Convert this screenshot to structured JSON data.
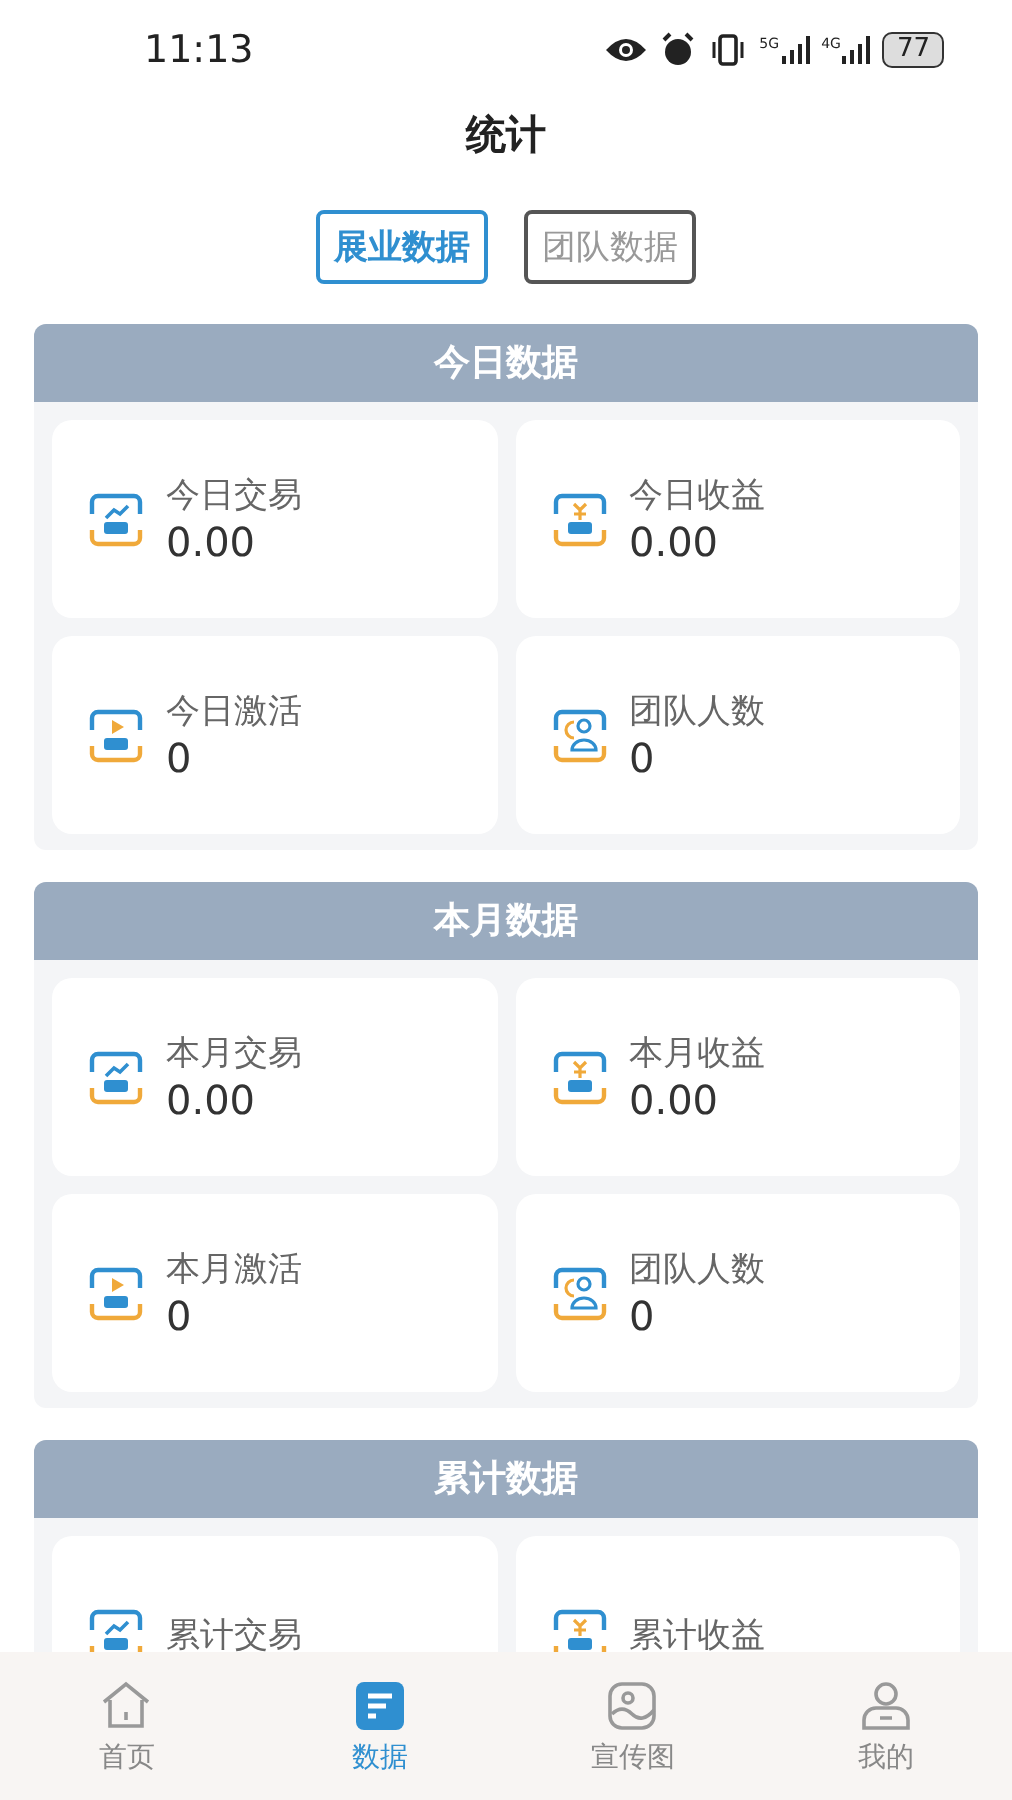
{
  "status_bar": {
    "time": "11:13",
    "signals": [
      "5G",
      "4G"
    ],
    "battery": "77"
  },
  "title": "统计",
  "tabs": [
    {
      "label": "展业数据",
      "selected": true
    },
    {
      "label": "团队数据",
      "selected": false
    }
  ],
  "sections": [
    {
      "title": "今日数据",
      "items": [
        {
          "kind": "trade",
          "label": "今日交易",
          "value": "0.00"
        },
        {
          "kind": "income",
          "label": "今日收益",
          "value": "0.00"
        },
        {
          "kind": "activate",
          "label": "今日激活",
          "value": "0"
        },
        {
          "kind": "team",
          "label": "团队人数",
          "value": "0"
        }
      ]
    },
    {
      "title": "本月数据",
      "items": [
        {
          "kind": "trade",
          "label": "本月交易",
          "value": "0.00"
        },
        {
          "kind": "income",
          "label": "本月收益",
          "value": "0.00"
        },
        {
          "kind": "activate",
          "label": "本月激活",
          "value": "0"
        },
        {
          "kind": "team",
          "label": "团队人数",
          "value": "0"
        }
      ]
    },
    {
      "title": "累计数据",
      "items": [
        {
          "kind": "trade",
          "label": "累计交易"
        },
        {
          "kind": "income",
          "label": "累计收益"
        }
      ]
    }
  ],
  "nav": [
    {
      "kind": "home",
      "label": "首页",
      "selected": false
    },
    {
      "kind": "data",
      "label": "数据",
      "selected": true
    },
    {
      "kind": "poster",
      "label": "宣传图",
      "selected": false
    },
    {
      "kind": "me",
      "label": "我的",
      "selected": false
    }
  ]
}
